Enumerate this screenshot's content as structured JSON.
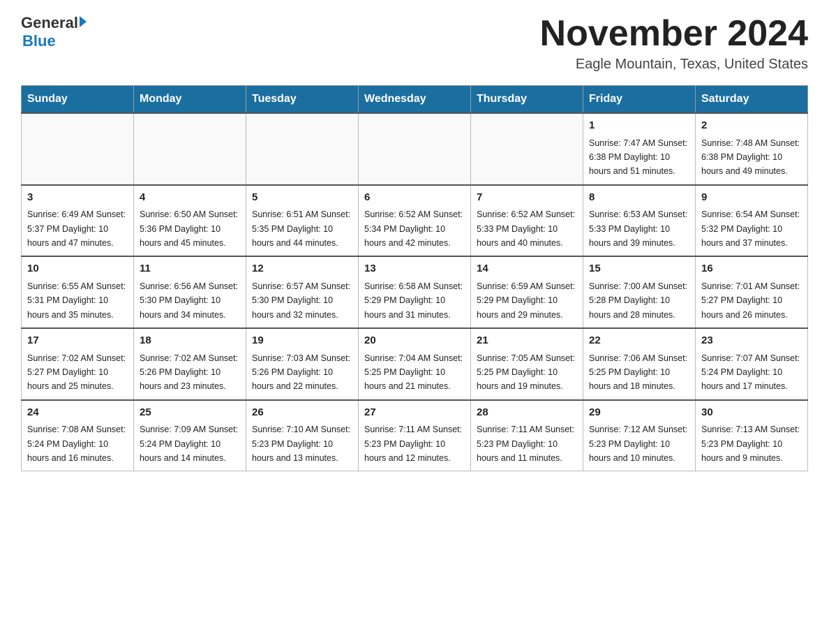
{
  "header": {
    "logo_general": "General",
    "logo_blue": "Blue",
    "month_title": "November 2024",
    "location": "Eagle Mountain, Texas, United States"
  },
  "weekdays": [
    "Sunday",
    "Monday",
    "Tuesday",
    "Wednesday",
    "Thursday",
    "Friday",
    "Saturday"
  ],
  "weeks": [
    [
      {
        "day": "",
        "info": ""
      },
      {
        "day": "",
        "info": ""
      },
      {
        "day": "",
        "info": ""
      },
      {
        "day": "",
        "info": ""
      },
      {
        "day": "",
        "info": ""
      },
      {
        "day": "1",
        "info": "Sunrise: 7:47 AM\nSunset: 6:38 PM\nDaylight: 10 hours and 51 minutes."
      },
      {
        "day": "2",
        "info": "Sunrise: 7:48 AM\nSunset: 6:38 PM\nDaylight: 10 hours and 49 minutes."
      }
    ],
    [
      {
        "day": "3",
        "info": "Sunrise: 6:49 AM\nSunset: 5:37 PM\nDaylight: 10 hours and 47 minutes."
      },
      {
        "day": "4",
        "info": "Sunrise: 6:50 AM\nSunset: 5:36 PM\nDaylight: 10 hours and 45 minutes."
      },
      {
        "day": "5",
        "info": "Sunrise: 6:51 AM\nSunset: 5:35 PM\nDaylight: 10 hours and 44 minutes."
      },
      {
        "day": "6",
        "info": "Sunrise: 6:52 AM\nSunset: 5:34 PM\nDaylight: 10 hours and 42 minutes."
      },
      {
        "day": "7",
        "info": "Sunrise: 6:52 AM\nSunset: 5:33 PM\nDaylight: 10 hours and 40 minutes."
      },
      {
        "day": "8",
        "info": "Sunrise: 6:53 AM\nSunset: 5:33 PM\nDaylight: 10 hours and 39 minutes."
      },
      {
        "day": "9",
        "info": "Sunrise: 6:54 AM\nSunset: 5:32 PM\nDaylight: 10 hours and 37 minutes."
      }
    ],
    [
      {
        "day": "10",
        "info": "Sunrise: 6:55 AM\nSunset: 5:31 PM\nDaylight: 10 hours and 35 minutes."
      },
      {
        "day": "11",
        "info": "Sunrise: 6:56 AM\nSunset: 5:30 PM\nDaylight: 10 hours and 34 minutes."
      },
      {
        "day": "12",
        "info": "Sunrise: 6:57 AM\nSunset: 5:30 PM\nDaylight: 10 hours and 32 minutes."
      },
      {
        "day": "13",
        "info": "Sunrise: 6:58 AM\nSunset: 5:29 PM\nDaylight: 10 hours and 31 minutes."
      },
      {
        "day": "14",
        "info": "Sunrise: 6:59 AM\nSunset: 5:29 PM\nDaylight: 10 hours and 29 minutes."
      },
      {
        "day": "15",
        "info": "Sunrise: 7:00 AM\nSunset: 5:28 PM\nDaylight: 10 hours and 28 minutes."
      },
      {
        "day": "16",
        "info": "Sunrise: 7:01 AM\nSunset: 5:27 PM\nDaylight: 10 hours and 26 minutes."
      }
    ],
    [
      {
        "day": "17",
        "info": "Sunrise: 7:02 AM\nSunset: 5:27 PM\nDaylight: 10 hours and 25 minutes."
      },
      {
        "day": "18",
        "info": "Sunrise: 7:02 AM\nSunset: 5:26 PM\nDaylight: 10 hours and 23 minutes."
      },
      {
        "day": "19",
        "info": "Sunrise: 7:03 AM\nSunset: 5:26 PM\nDaylight: 10 hours and 22 minutes."
      },
      {
        "day": "20",
        "info": "Sunrise: 7:04 AM\nSunset: 5:25 PM\nDaylight: 10 hours and 21 minutes."
      },
      {
        "day": "21",
        "info": "Sunrise: 7:05 AM\nSunset: 5:25 PM\nDaylight: 10 hours and 19 minutes."
      },
      {
        "day": "22",
        "info": "Sunrise: 7:06 AM\nSunset: 5:25 PM\nDaylight: 10 hours and 18 minutes."
      },
      {
        "day": "23",
        "info": "Sunrise: 7:07 AM\nSunset: 5:24 PM\nDaylight: 10 hours and 17 minutes."
      }
    ],
    [
      {
        "day": "24",
        "info": "Sunrise: 7:08 AM\nSunset: 5:24 PM\nDaylight: 10 hours and 16 minutes."
      },
      {
        "day": "25",
        "info": "Sunrise: 7:09 AM\nSunset: 5:24 PM\nDaylight: 10 hours and 14 minutes."
      },
      {
        "day": "26",
        "info": "Sunrise: 7:10 AM\nSunset: 5:23 PM\nDaylight: 10 hours and 13 minutes."
      },
      {
        "day": "27",
        "info": "Sunrise: 7:11 AM\nSunset: 5:23 PM\nDaylight: 10 hours and 12 minutes."
      },
      {
        "day": "28",
        "info": "Sunrise: 7:11 AM\nSunset: 5:23 PM\nDaylight: 10 hours and 11 minutes."
      },
      {
        "day": "29",
        "info": "Sunrise: 7:12 AM\nSunset: 5:23 PM\nDaylight: 10 hours and 10 minutes."
      },
      {
        "day": "30",
        "info": "Sunrise: 7:13 AM\nSunset: 5:23 PM\nDaylight: 10 hours and 9 minutes."
      }
    ]
  ]
}
